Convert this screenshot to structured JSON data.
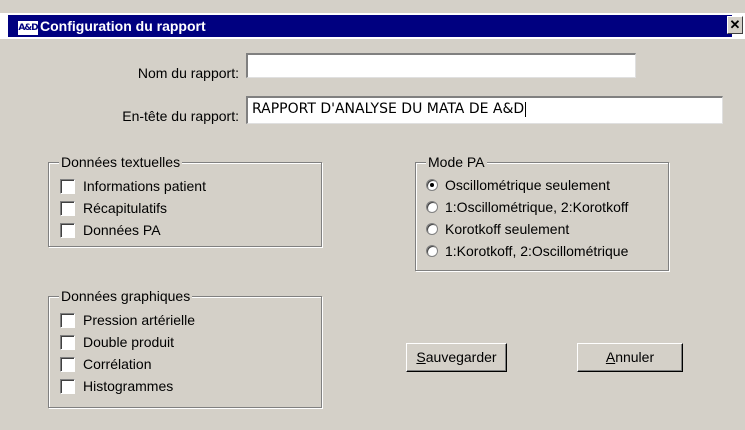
{
  "window": {
    "icon_text": "A&D",
    "title": "Configuration du rapport",
    "close_glyph": "✕"
  },
  "form": {
    "report_name_label": "Nom du rapport:",
    "report_name_value": "",
    "report_header_label": "En-tête du rapport:",
    "report_header_value": "RAPPORT D'ANALYSE DU MATA DE A&D"
  },
  "text_data": {
    "legend": "Données textuelles",
    "items": [
      {
        "label": "Informations patient",
        "checked": false
      },
      {
        "label": "Récapitulatifs",
        "checked": false
      },
      {
        "label": "Données PA",
        "checked": false
      }
    ]
  },
  "graph_data": {
    "legend": "Données graphiques",
    "items": [
      {
        "label": "Pression artérielle",
        "checked": false
      },
      {
        "label": "Double produit",
        "checked": false
      },
      {
        "label": "Corrélation",
        "checked": false
      },
      {
        "label": "Histogrammes",
        "checked": false
      }
    ]
  },
  "mode_pa": {
    "legend": "Mode PA",
    "options": [
      {
        "label": "Oscillométrique seulement",
        "selected": true
      },
      {
        "label": "1:Oscillométrique, 2:Korotkoff",
        "selected": false
      },
      {
        "label": "Korotkoff seulement",
        "selected": false
      },
      {
        "label": "1:Korotkoff, 2:Oscillométrique",
        "selected": false
      }
    ]
  },
  "buttons": {
    "save_mnemonic": "S",
    "save_rest": "auvegarder",
    "cancel_mnemonic": "A",
    "cancel_rest": "nnuler"
  }
}
